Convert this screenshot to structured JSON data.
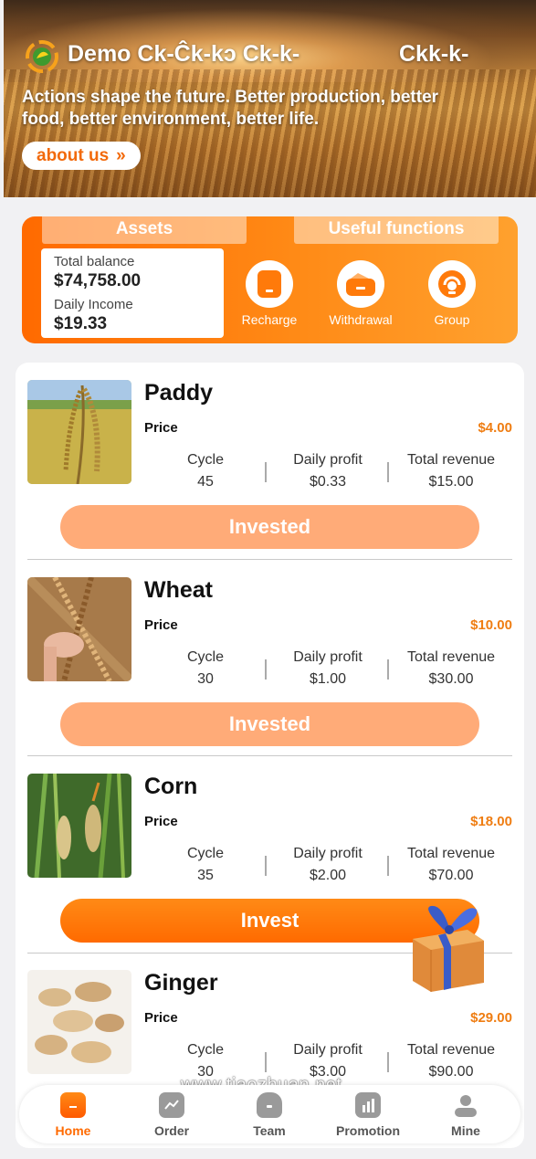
{
  "hero": {
    "brand": "Demo Ck-Ĉk-kↄ Ck-k-",
    "brand_right": "Ckk-k-",
    "slogan": "Actions shape the future. Better production, better food, better environment, better life.",
    "about_label": "about us",
    "about_icon": "double-chevron-right-icon"
  },
  "assets": {
    "tab_assets": "Assets",
    "tab_functions": "Useful functions",
    "total_balance_label": "Total balance",
    "total_balance_value": "$74,758.00",
    "daily_income_label": "Daily Income",
    "daily_income_value": "$19.33",
    "functions": [
      {
        "label": "Recharge",
        "icon": "wallet-icon"
      },
      {
        "label": "Withdrawal",
        "icon": "purse-icon"
      },
      {
        "label": "Group",
        "icon": "headset-icon"
      }
    ]
  },
  "labels": {
    "price": "Price",
    "cycle": "Cycle",
    "daily_profit": "Daily profit",
    "total_revenue": "Total revenue"
  },
  "products": [
    {
      "name": "Paddy",
      "price": "$4.00",
      "cycle": "45",
      "daily_profit": "$0.33",
      "total_revenue": "$15.00",
      "button": "Invested",
      "status": "invested"
    },
    {
      "name": "Wheat",
      "price": "$10.00",
      "cycle": "30",
      "daily_profit": "$1.00",
      "total_revenue": "$30.00",
      "button": "Invested",
      "status": "invested"
    },
    {
      "name": "Corn",
      "price": "$18.00",
      "cycle": "35",
      "daily_profit": "$2.00",
      "total_revenue": "$70.00",
      "button": "Invest",
      "status": "available"
    },
    {
      "name": "Ginger",
      "price": "$29.00",
      "cycle": "30",
      "daily_profit": "$3.00",
      "total_revenue": "$90.00",
      "button": "",
      "status": "partial"
    }
  ],
  "watermark": "www.tiaozhuan.net",
  "nav": [
    {
      "label": "Home",
      "icon": "home-icon",
      "active": true
    },
    {
      "label": "Order",
      "icon": "chart-icon",
      "active": false
    },
    {
      "label": "Team",
      "icon": "lock-icon",
      "active": false
    },
    {
      "label": "Promotion",
      "icon": "bar-chart-icon",
      "active": false
    },
    {
      "label": "Mine",
      "icon": "user-icon",
      "active": false
    }
  ],
  "colors": {
    "accent": "#ff6a00",
    "price": "#ef7d12",
    "invested_button": "#ffab78"
  }
}
